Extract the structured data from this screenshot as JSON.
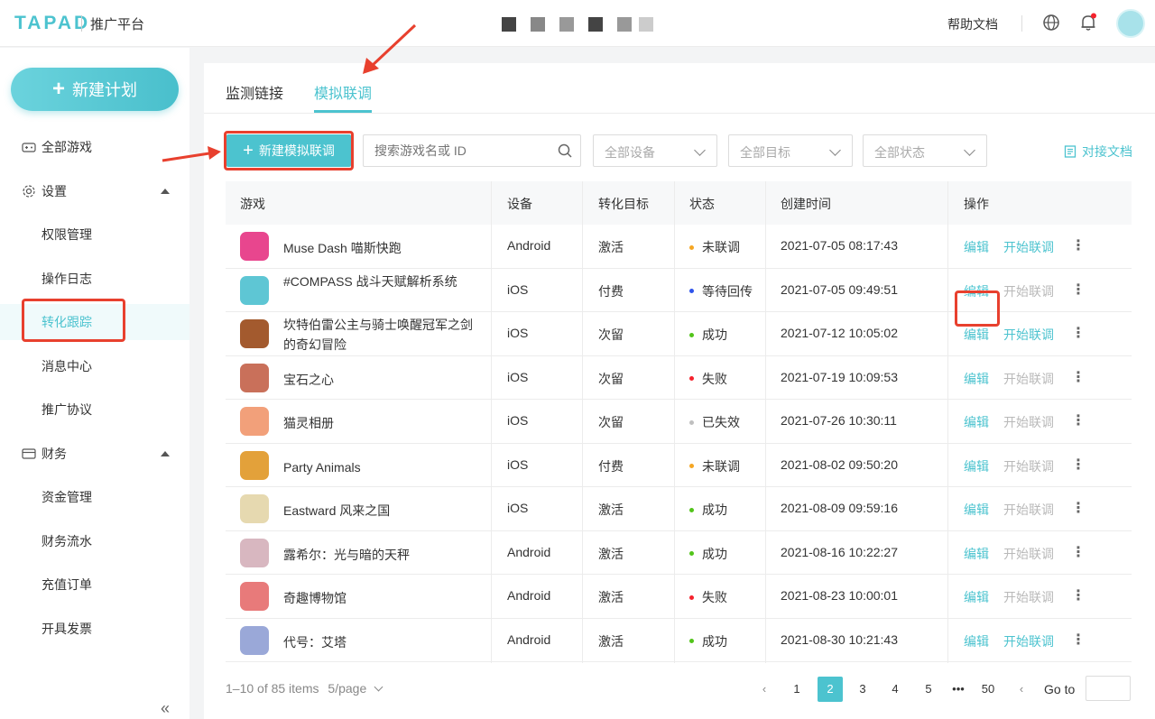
{
  "header": {
    "logo": "TAPAD",
    "platform": "推广平台",
    "help": "帮助文档"
  },
  "sidebar": {
    "new_plan": "新建计划",
    "items": [
      {
        "label": "全部游戏",
        "icon": "gamepad-icon"
      },
      {
        "label": "设置",
        "icon": "gear-icon"
      },
      {
        "label": "权限管理"
      },
      {
        "label": "操作日志"
      },
      {
        "label": "转化跟踪"
      },
      {
        "label": "消息中心"
      },
      {
        "label": "推广协议"
      },
      {
        "label": "财务",
        "icon": "wallet-icon"
      },
      {
        "label": "资金管理"
      },
      {
        "label": "财务流水"
      },
      {
        "label": "充值订单"
      },
      {
        "label": "开具发票"
      }
    ],
    "collapse": "«"
  },
  "tabs": [
    {
      "label": "监测链接"
    },
    {
      "label": "模拟联调"
    }
  ],
  "toolbar": {
    "new_button": "新建模拟联调",
    "search_placeholder": "搜索游戏名或 ID",
    "device_select": "全部设备",
    "target_select": "全部目标",
    "status_select": "全部状态",
    "doc_link": "对接文档"
  },
  "table": {
    "headers": [
      "游戏",
      "设备",
      "转化目标",
      "状态",
      "创建时间",
      "操作"
    ],
    "edit_label": "编辑",
    "start_label": "开始联调",
    "more_label": "⋮",
    "rows": [
      {
        "game": "Muse Dash 喵斯快跑",
        "device": "Android",
        "target": "激活",
        "status": "未联调",
        "status_color": "#f5a623",
        "created": "2021-07-05 08:17:43",
        "start_enabled": true,
        "icon_color": "#e8468e"
      },
      {
        "game": "#COMPASS 战斗天赋解析系统",
        "device": "iOS",
        "target": "付费",
        "status": "等待回传",
        "status_color": "#2f54eb",
        "created": "2021-07-05 09:49:51",
        "start_enabled": false,
        "icon_color": "#5ec6d4"
      },
      {
        "game": "坎特伯雷公主与骑士唤醒冠军之剑的奇幻冒险",
        "device": "iOS",
        "target": "次留",
        "status": "成功",
        "status_color": "#52c41a",
        "created": "2021-07-12 10:05:02",
        "start_enabled": true,
        "icon_color": "#a35a2e"
      },
      {
        "game": "宝石之心",
        "device": "iOS",
        "target": "次留",
        "status": "失败",
        "status_color": "#f5222d",
        "created": "2021-07-19 10:09:53",
        "start_enabled": false,
        "icon_color": "#c9705a"
      },
      {
        "game": "猫灵相册",
        "device": "iOS",
        "target": "次留",
        "status": "已失效",
        "status_color": "#bfbfbf",
        "created": "2021-07-26 10:30:11",
        "start_enabled": false,
        "icon_color": "#f2a07a"
      },
      {
        "game": "Party Animals",
        "device": "iOS",
        "target": "付费",
        "status": "未联调",
        "status_color": "#f5a623",
        "created": "2021-08-02 09:50:20",
        "start_enabled": false,
        "icon_color": "#e3a13a"
      },
      {
        "game": "Eastward 风来之国",
        "device": "iOS",
        "target": "激活",
        "status": "成功",
        "status_color": "#52c41a",
        "created": "2021-08-09 09:59:16",
        "start_enabled": false,
        "icon_color": "#e6d9b0"
      },
      {
        "game": "露希尔：光与暗的天秤",
        "device": "Android",
        "target": "激活",
        "status": "成功",
        "status_color": "#52c41a",
        "created": "2021-08-16 10:22:27",
        "start_enabled": false,
        "icon_color": "#d8b7c0"
      },
      {
        "game": "奇趣博物馆",
        "device": "Android",
        "target": "激活",
        "status": "失败",
        "status_color": "#f5222d",
        "created": "2021-08-23 10:00:01",
        "start_enabled": false,
        "icon_color": "#e87a7a"
      },
      {
        "game": "代号：艾塔",
        "device": "Android",
        "target": "激活",
        "status": "成功",
        "status_color": "#52c41a",
        "created": "2021-08-30 10:21:43",
        "start_enabled": true,
        "icon_color": "#9aa8d8"
      }
    ]
  },
  "pagination": {
    "summary": "1–10 of 85 items",
    "page_size": "5/page",
    "pages": [
      "1",
      "2",
      "3",
      "4",
      "5",
      "•••",
      "50"
    ],
    "current": "2",
    "goto": "Go to"
  },
  "colors": {
    "accent": "#4cc3cf",
    "annotation": "#e8402e"
  }
}
